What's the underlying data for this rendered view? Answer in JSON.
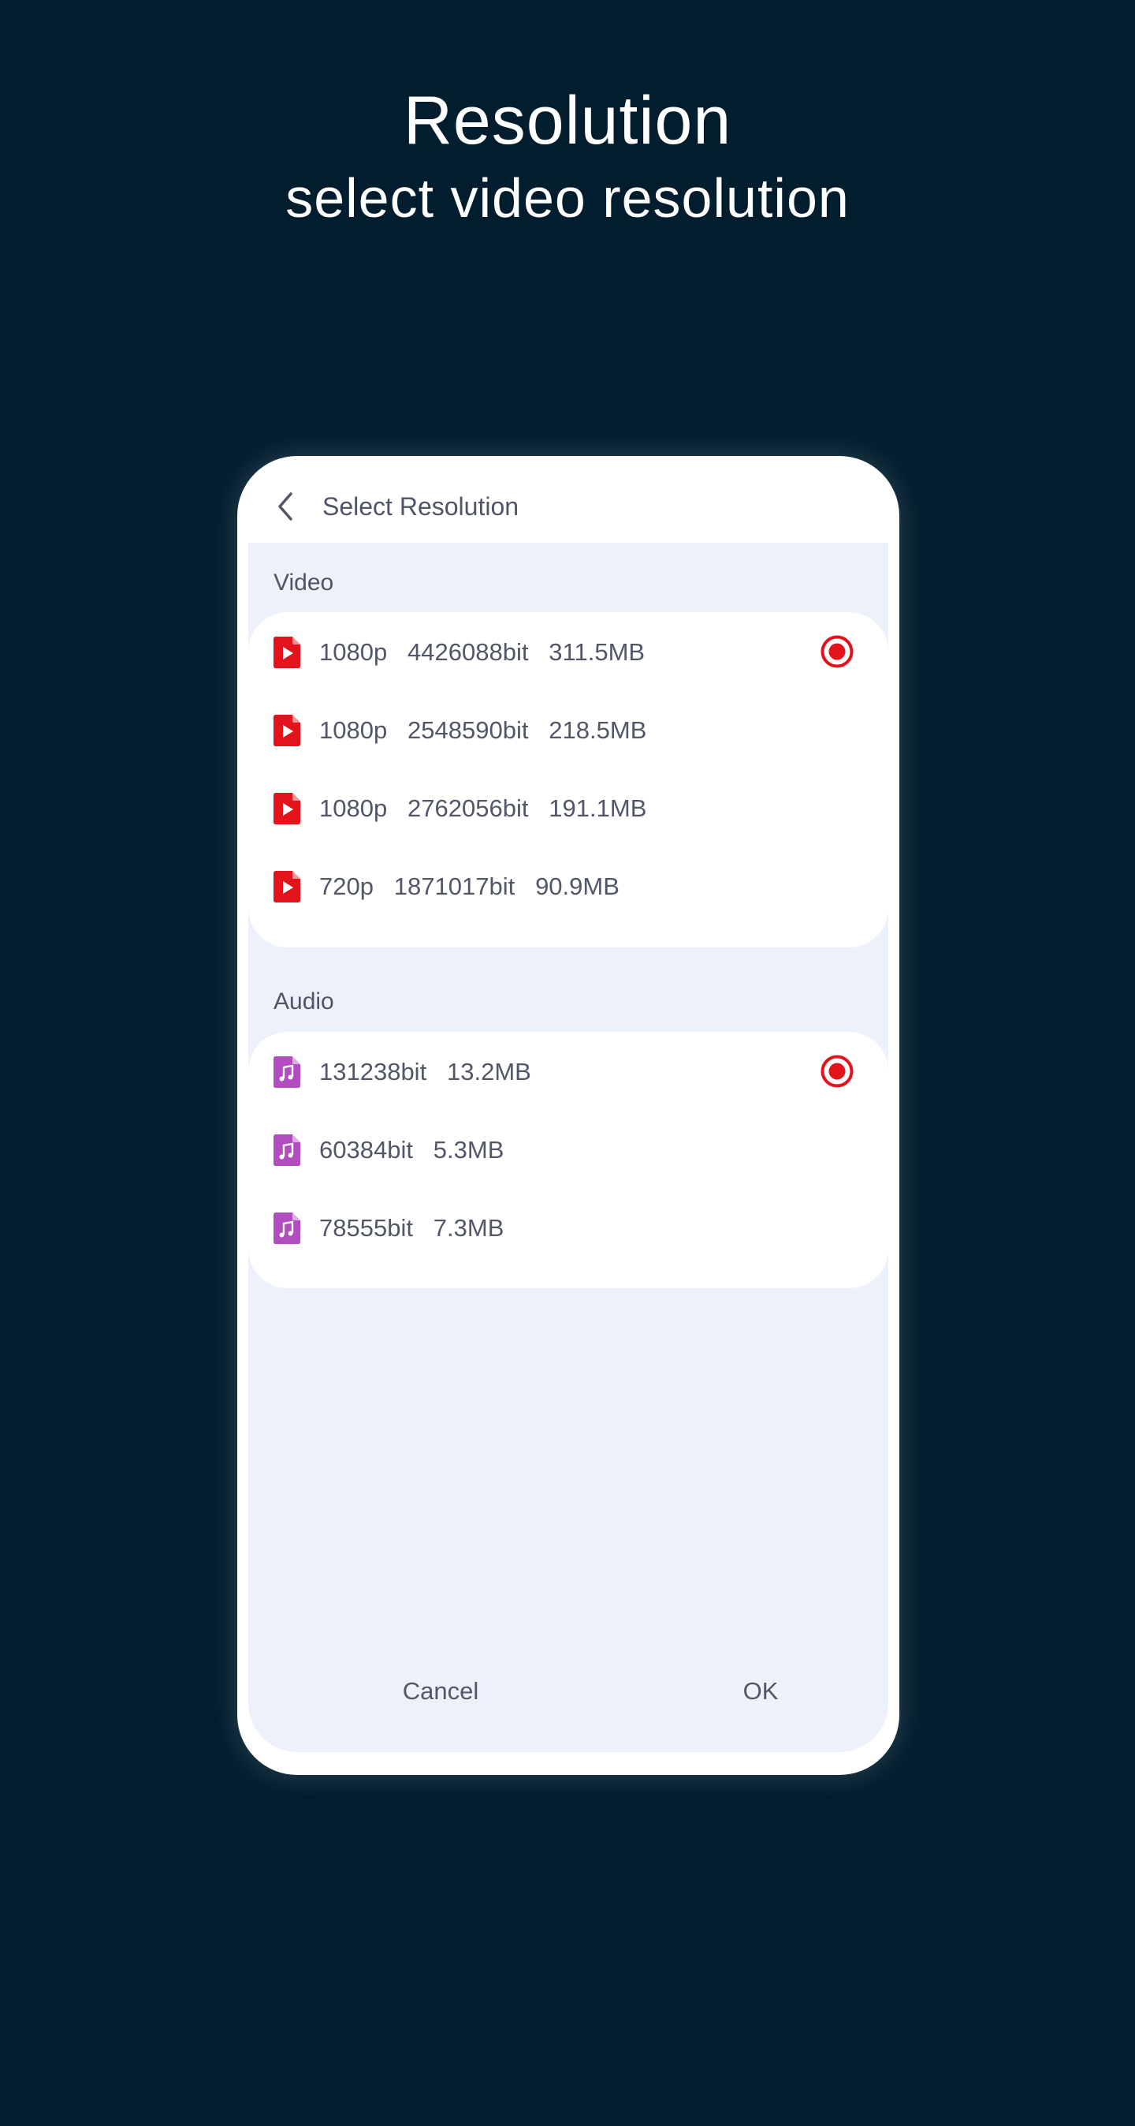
{
  "promo": {
    "title": "Resolution",
    "subtitle": "select video resolution"
  },
  "dialog": {
    "title": "Select Resolution",
    "video_section_label": "Video",
    "audio_section_label": "Audio",
    "video_items": [
      {
        "text": "1080p   4426088bit   311.5MB",
        "selected": true
      },
      {
        "text": "1080p   2548590bit   218.5MB",
        "selected": false
      },
      {
        "text": "1080p   2762056bit   191.1MB",
        "selected": false
      },
      {
        "text": "720p   1871017bit   90.9MB",
        "selected": false
      }
    ],
    "audio_items": [
      {
        "text": "131238bit   13.2MB",
        "selected": true
      },
      {
        "text": "60384bit   5.3MB",
        "selected": false
      },
      {
        "text": "78555bit   7.3MB",
        "selected": false
      }
    ],
    "cancel_label": "Cancel",
    "ok_label": "OK"
  },
  "colors": {
    "background": "#021d2e",
    "accent_red": "#e3131b",
    "audio_icon_purple": "#b14dbf",
    "panel": "#edf1fa",
    "text": "#525767"
  },
  "icons": {
    "back": "chevron-left-icon",
    "video_file": "video-file-icon",
    "audio_file": "audio-file-icon",
    "radio_selected": "radio-selected-icon"
  }
}
